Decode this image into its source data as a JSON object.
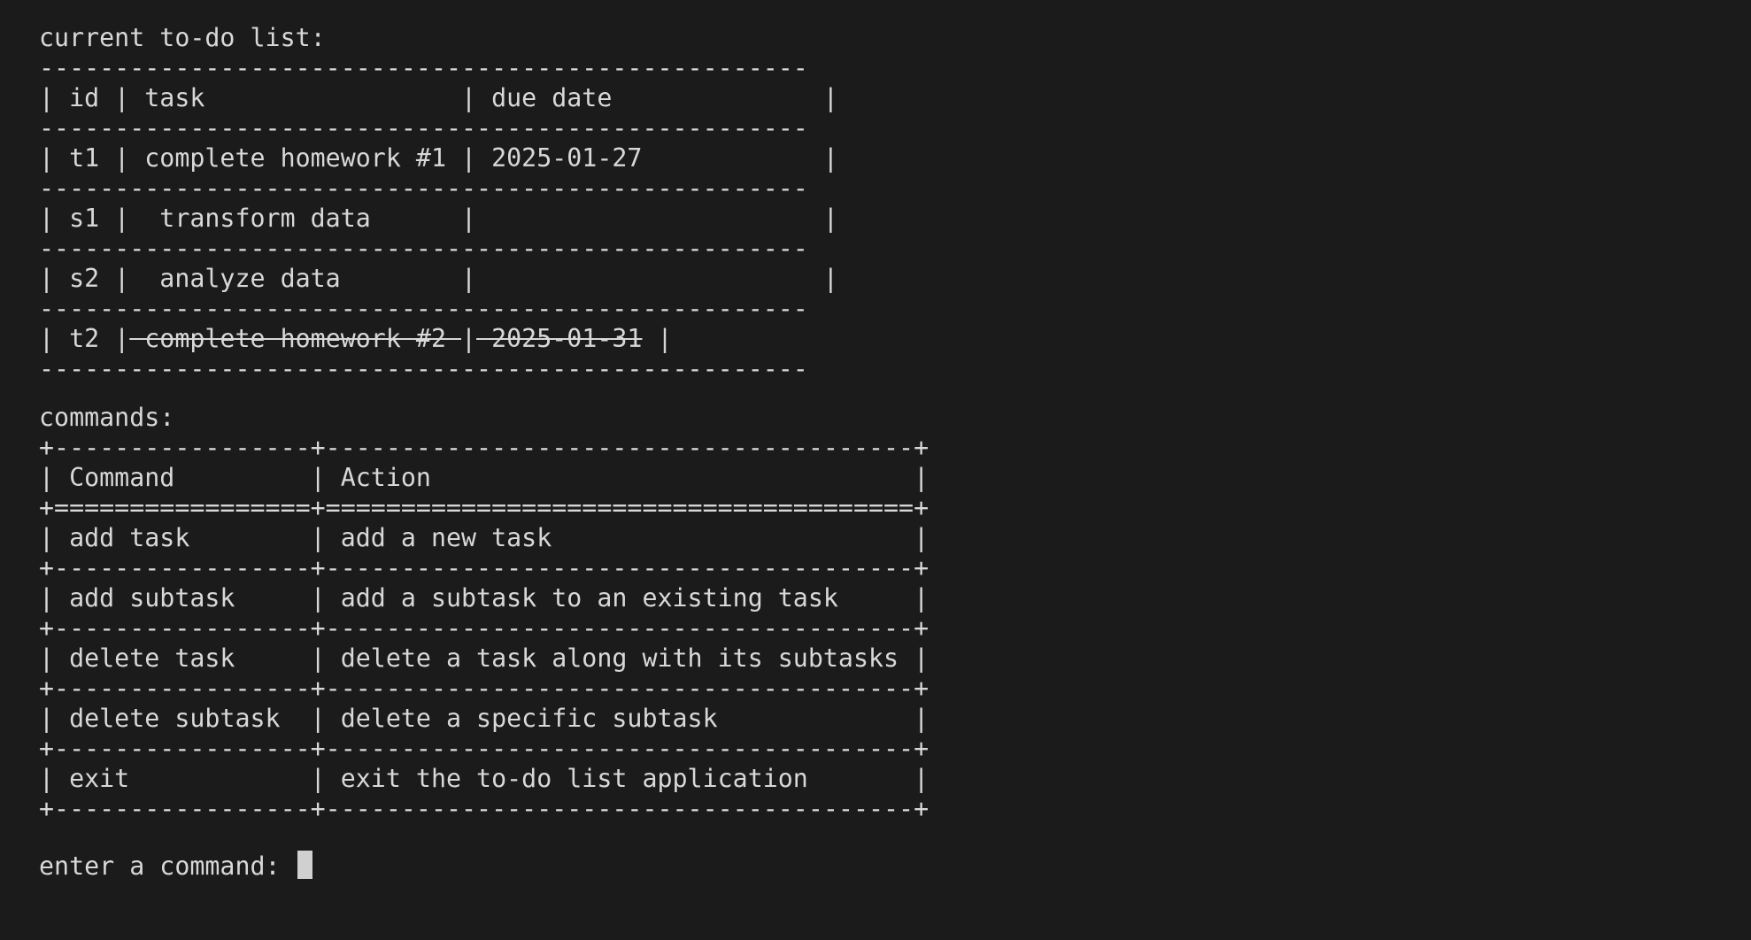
{
  "todo": {
    "heading": "current to-do list:",
    "rule": "---------------------------------------------------",
    "header": "| id | task                 | due date              |",
    "rows": [
      {
        "text": "| t1 | complete homework #1 | 2025-01-27            |",
        "done": false
      },
      {
        "text": "| s1 |  transform data      |                       |",
        "done": false
      },
      {
        "text": "| s2 |  analyze data        |                       |",
        "done": false
      }
    ],
    "done_row": {
      "prefix": "| t2 |",
      "task": " complete homework #2 ",
      "mid": "|",
      "date": " 2025-01-31",
      "suffix": " |"
    }
  },
  "commands": {
    "heading": "commands:",
    "border": "+-----------------+---------------------------------------+",
    "header_border": "+=================+=======================================+",
    "header": "| Command         | Action                                |",
    "rows": [
      "| add task        | add a new task                        |",
      "| add subtask     | add a subtask to an existing task     |",
      "| delete task     | delete a task along with its subtasks |",
      "| delete subtask  | delete a specific subtask             |",
      "| exit            | exit the to-do list application       |"
    ]
  },
  "prompt": {
    "label": "enter a command: "
  }
}
